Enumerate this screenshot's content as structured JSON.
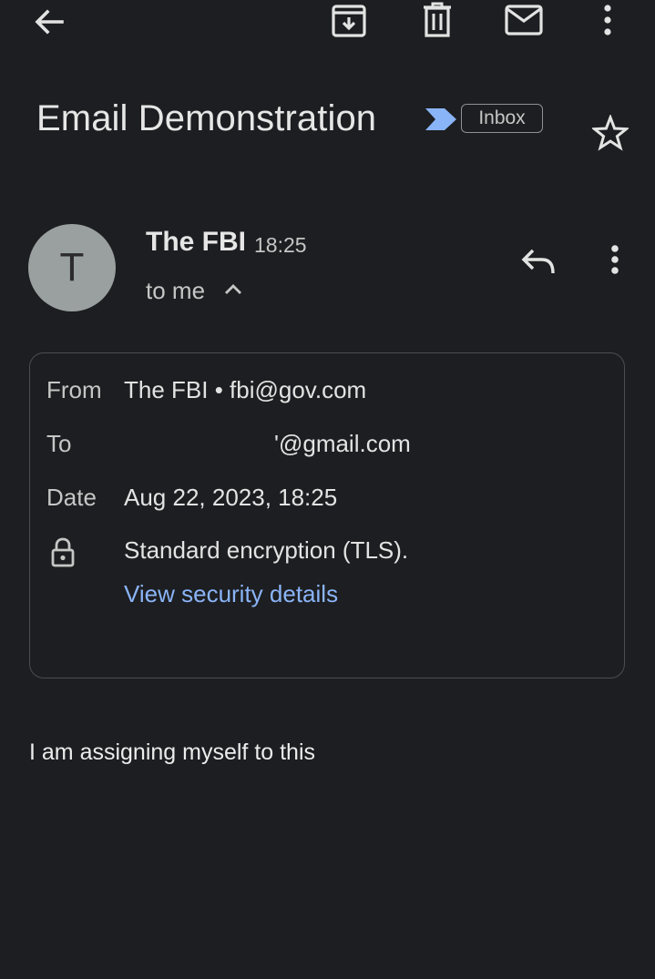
{
  "toolbar": {
    "back_icon": "arrow-back-icon",
    "archive_icon": "archive-icon",
    "delete_icon": "trash-icon",
    "mark_unread_icon": "mail-icon",
    "more_icon": "more-vert-icon"
  },
  "thread": {
    "subject": "Email Demonstration",
    "importance_icon": "importance-marker-icon",
    "label": "Inbox",
    "star_icon": "star-outline-icon"
  },
  "message": {
    "avatar_initial": "T",
    "sender_name": "The FBI",
    "time": "18:25",
    "recipient_summary": "to me",
    "reply_icon": "reply-icon",
    "more_icon": "more-vert-icon"
  },
  "details": {
    "from_label": "From",
    "from_value": "The FBI • fbi@gov.com",
    "to_label": "To",
    "to_value": "'@gmail.com",
    "date_label": "Date",
    "date_value": "Aug 22, 2023, 18:25",
    "lock_icon": "lock-icon",
    "encryption": "Standard encryption (TLS).",
    "security_link": "View security details"
  },
  "body": {
    "text": "I am assigning myself to this"
  },
  "colors": {
    "background": "#1d1e21",
    "link": "#8ab4f8",
    "importance": "#8ab4f8",
    "avatar": "#9aa0a0"
  }
}
